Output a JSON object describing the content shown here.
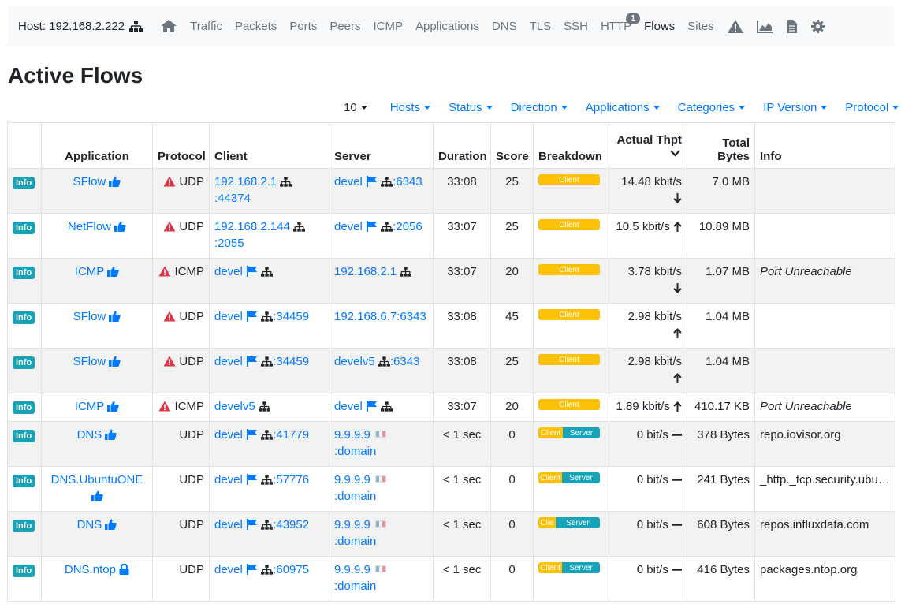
{
  "navbar": {
    "host_label": "Host: 192.168.2.222",
    "items": [
      "Traffic",
      "Packets",
      "Ports",
      "Peers",
      "ICMP",
      "Applications",
      "DNS",
      "TLS",
      "SSH",
      "HTTP",
      "Flows",
      "Sites"
    ],
    "http_badge": "1",
    "active": "Flows",
    "icons": [
      "home-icon",
      "alert-icon",
      "area-chart-icon",
      "document-icon",
      "gear-icon"
    ]
  },
  "page_title": "Active Flows",
  "filters": {
    "page_size": "10",
    "hosts": "Hosts",
    "status": "Status",
    "direction": "Direction",
    "applications": "Applications",
    "categories": "Categories",
    "ip_version": "IP Version",
    "protocol": "Protocol"
  },
  "table": {
    "headers": {
      "application": "Application",
      "protocol": "Protocol",
      "client": "Client",
      "server": "Server",
      "duration": "Duration",
      "score": "Score",
      "breakdown": "Breakdown",
      "thpt": "Actual Thpt",
      "bytes_line1": "Total",
      "bytes_line2": "Bytes",
      "info": "Info"
    },
    "info_label": "Info",
    "client_label": "Client",
    "server_label": "Server",
    "rows": [
      {
        "app": "SFlow",
        "app_icon": "thumbs-up-icon",
        "proto": "UDP",
        "warn": true,
        "client": "192.168.2.1",
        "client_port": ":44374",
        "server": "devel",
        "server_port": ":6343",
        "duration": "33:08",
        "score": "25",
        "client_pct": 100,
        "client_text": "Client",
        "server_text": "",
        "thpt": "14.48 kbit/s",
        "trend": "down",
        "bytes": "7.0 MB",
        "info": ""
      },
      {
        "app": "NetFlow",
        "app_icon": "thumbs-up-icon",
        "proto": "UDP",
        "warn": true,
        "client": "192.168.2.144",
        "client_port": ":2055",
        "server": "devel",
        "server_port": ":2056",
        "duration": "33:07",
        "score": "25",
        "client_pct": 100,
        "client_text": "Client",
        "server_text": "",
        "thpt": "10.5 kbit/s",
        "trend": "up",
        "bytes": "10.89 MB",
        "info": ""
      },
      {
        "app": "ICMP",
        "app_icon": "thumbs-up-icon",
        "proto": "ICMP",
        "warn": true,
        "client": "devel",
        "client_port": "",
        "server": "192.168.2.1",
        "server_port": "",
        "duration": "33:07",
        "score": "20",
        "client_pct": 100,
        "client_text": "Client",
        "server_text": "",
        "thpt": "3.78 kbit/s",
        "trend": "down",
        "bytes": "1.07 MB",
        "info": "Port Unreachable"
      },
      {
        "app": "SFlow",
        "app_icon": "thumbs-up-icon",
        "proto": "UDP",
        "warn": true,
        "client": "devel",
        "client_port": ":34459",
        "server": "192.168.6.7:6343",
        "server_port": "",
        "duration": "33:08",
        "score": "45",
        "client_pct": 100,
        "client_text": "Client",
        "server_text": "",
        "thpt": "2.98 kbit/s",
        "trend": "up",
        "bytes": "1.04 MB",
        "info": ""
      },
      {
        "app": "SFlow",
        "app_icon": "thumbs-up-icon",
        "proto": "UDP",
        "warn": true,
        "client": "devel",
        "client_port": ":34459",
        "server": "develv5",
        "server_port": ":6343",
        "duration": "33:08",
        "score": "25",
        "client_pct": 100,
        "client_text": "Client",
        "server_text": "",
        "thpt": "2.98 kbit/s",
        "trend": "up",
        "bytes": "1.04 MB",
        "info": ""
      },
      {
        "app": "ICMP",
        "app_icon": "thumbs-up-icon",
        "proto": "ICMP",
        "warn": true,
        "client": "develv5",
        "client_port": "",
        "server": "devel",
        "server_port": "",
        "duration": "33:07",
        "score": "20",
        "client_pct": 100,
        "client_text": "Client",
        "server_text": "",
        "thpt": "1.89 kbit/s",
        "trend": "up",
        "bytes": "410.17 KB",
        "info": "Port Unreachable"
      },
      {
        "app": "DNS",
        "app_icon": "thumbs-up-icon",
        "proto": "UDP",
        "warn": false,
        "client": "devel",
        "client_port": ":41779",
        "server": "9.9.9.9",
        "server_port": ":domain",
        "duration": "< 1 sec",
        "score": "0",
        "client_pct": 40,
        "client_text": "Client",
        "server_text": "Server",
        "thpt": "0 bit/s",
        "trend": "flat",
        "bytes": "378 Bytes",
        "info": "repo.iovisor.org"
      },
      {
        "app": "DNS.UbuntuONE",
        "app_icon": "thumbs-up-icon",
        "proto": "UDP",
        "warn": false,
        "client": "devel",
        "client_port": ":57776",
        "server": "9.9.9.9",
        "server_port": ":domain",
        "duration": "< 1 sec",
        "score": "0",
        "client_pct": 38,
        "client_text": "Client",
        "server_text": "Server",
        "thpt": "0 bit/s",
        "trend": "flat",
        "bytes": "241 Bytes",
        "info": "_http._tcp.security.ubuntu.com"
      },
      {
        "app": "DNS",
        "app_icon": "thumbs-up-icon",
        "proto": "UDP",
        "warn": false,
        "client": "devel",
        "client_port": ":43952",
        "server": "9.9.9.9",
        "server_port": ":domain",
        "duration": "< 1 sec",
        "score": "0",
        "client_pct": 28,
        "client_text": "Clie",
        "server_text": "Server",
        "thpt": "0 bit/s",
        "trend": "flat",
        "bytes": "608 Bytes",
        "info": "repos.influxdata.com"
      },
      {
        "app": "DNS.ntop",
        "app_icon": "lock-icon",
        "proto": "UDP",
        "warn": false,
        "client": "devel",
        "client_port": ":60975",
        "server": "9.9.9.9",
        "server_port": ":domain",
        "duration": "< 1 sec",
        "score": "0",
        "client_pct": 38,
        "client_text": "Client",
        "server_text": "Server",
        "thpt": "0 bit/s",
        "trend": "flat",
        "bytes": "416 Bytes",
        "info": "packages.ntop.org"
      }
    ]
  }
}
